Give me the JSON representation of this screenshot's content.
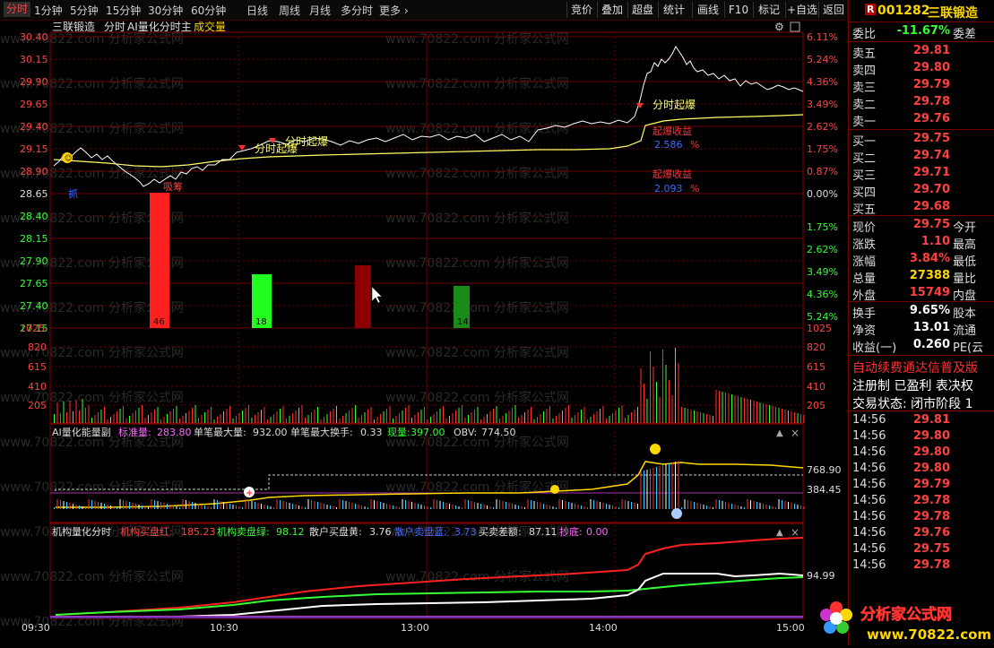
{
  "toolbar": {
    "periods": [
      "分时",
      "1分钟",
      "5分钟",
      "15分钟",
      "30分钟",
      "60分钟",
      "日线",
      "周线",
      "月线",
      "多分时",
      "更多"
    ],
    "right_buttons": [
      "竞价",
      "叠加",
      "超盘",
      "统计",
      "画线",
      "F10",
      "标记",
      "+自选",
      "返回"
    ]
  },
  "header": {
    "stock": "三联锻造",
    "mode": "分时",
    "formula": "AI量化分时主",
    "volume_label": "成交量"
  },
  "price_axis": {
    "left": [
      "30.40",
      "30.15",
      "29.90",
      "29.65",
      "29.40",
      "29.15",
      "28.90",
      "28.65",
      "28.40",
      "28.15",
      "27.90",
      "27.65",
      "27.40",
      "27.15"
    ],
    "right": [
      "6.11%",
      "5.24%",
      "4.36%",
      "3.49%",
      "2.62%",
      "1.75%",
      "0.87%",
      "0.00%",
      "1.75%",
      "2.62%",
      "3.49%",
      "4.36%",
      "5.24%"
    ]
  },
  "volume_axis": [
    "1025",
    "820",
    "615",
    "410",
    "205"
  ],
  "annotations": {
    "boom1": "分时起爆",
    "boom2": "分时起爆",
    "boom3": "分时起爆",
    "absorb": "吸筹",
    "grab": "抓",
    "gain_label": "起爆收益",
    "gain1": "2.586",
    "gain2": "2.093",
    "pct": "%",
    "bar1": "46",
    "bar2": "18",
    "bar4": "14"
  },
  "sub1": {
    "title": "AI量化能量副",
    "label1": "标准量:",
    "value1": "283.80",
    "label2": "单笔最大量:",
    "value2": "932.00",
    "label3": "单笔最大换手:",
    "value3": "0.33",
    "label4": "现量:",
    "value4": "397.00",
    "label5": "OBV:",
    "value5": "774.50",
    "axis_top": "768.90",
    "axis_mid": "384.45"
  },
  "sub2": {
    "title": "机构量化分时",
    "label1": "机构买盘红:",
    "value1": "185.23",
    "label2": "机构卖盘绿:",
    "value2": "98.12",
    "label3": "散户买盘黄:",
    "value3": "3.76",
    "label4": "散户卖盘蓝:",
    "value4": "3.73",
    "label5": "买卖差额:",
    "value5": "87.11",
    "label6": "抄底:",
    "value6": "0.00",
    "axis_top": "94.99"
  },
  "time_axis": [
    "09:30",
    "10:30",
    "13:00",
    "14:00",
    "15:00"
  ],
  "watermark": "www.70822.com 分析家公式网",
  "side_panel": {
    "code": "001282",
    "name": "三联锻造",
    "weibi_label": "委比",
    "weibi": "-11.67%",
    "weicha_label": "委差",
    "asks": [
      {
        "label": "卖五",
        "price": "29.81"
      },
      {
        "label": "卖四",
        "price": "29.80"
      },
      {
        "label": "卖三",
        "price": "29.79"
      },
      {
        "label": "卖二",
        "price": "29.78"
      },
      {
        "label": "卖一",
        "price": "29.76"
      }
    ],
    "bids": [
      {
        "label": "买一",
        "price": "29.75"
      },
      {
        "label": "买二",
        "price": "29.74"
      },
      {
        "label": "买三",
        "price": "29.71"
      },
      {
        "label": "买四",
        "price": "29.70"
      },
      {
        "label": "买五",
        "price": "29.68"
      }
    ],
    "stats": [
      {
        "label": "现价",
        "value": "29.75",
        "right": "今开"
      },
      {
        "label": "涨跌",
        "value": "1.10",
        "right": "最高"
      },
      {
        "label": "涨幅",
        "value": "3.84%",
        "right": "最低"
      },
      {
        "label": "总量",
        "value": "27388",
        "right": "量比"
      },
      {
        "label": "外盘",
        "value": "15749",
        "right": "内盘"
      }
    ],
    "stats2": [
      {
        "label": "换手",
        "value": "9.65%",
        "right": "股本"
      },
      {
        "label": "净资",
        "value": "13.01",
        "right": "流通"
      },
      {
        "label": "收益(一)",
        "value": "0.260",
        "right": "PE(云"
      }
    ],
    "notice1": "自动续费通达信普及版",
    "notice2": "注册制 已盈利 表决权",
    "status": "交易状态: 闭市阶段 1",
    "ticks": [
      {
        "time": "14:56",
        "price": "29.81"
      },
      {
        "time": "14:56",
        "price": "29.80"
      },
      {
        "time": "14:56",
        "price": "29.80"
      },
      {
        "time": "14:56",
        "price": "29.80"
      },
      {
        "time": "14:56",
        "price": "29.79"
      },
      {
        "time": "14:56",
        "price": "29.78"
      },
      {
        "time": "14:56",
        "price": "29.78"
      },
      {
        "time": "14:56",
        "price": "29.76"
      },
      {
        "time": "14:56",
        "price": "29.75"
      },
      {
        "time": "14:56",
        "price": "29.78"
      }
    ]
  },
  "logo": {
    "text": "分析家公式网",
    "url": "www.70822.com"
  },
  "colors": {
    "up": "#ff3333",
    "down": "#33ff33",
    "grid": "#8b0000",
    "price_line": "#ffffff",
    "avg_line": "#ffff66",
    "accent_yellow": "#ffd700"
  }
}
